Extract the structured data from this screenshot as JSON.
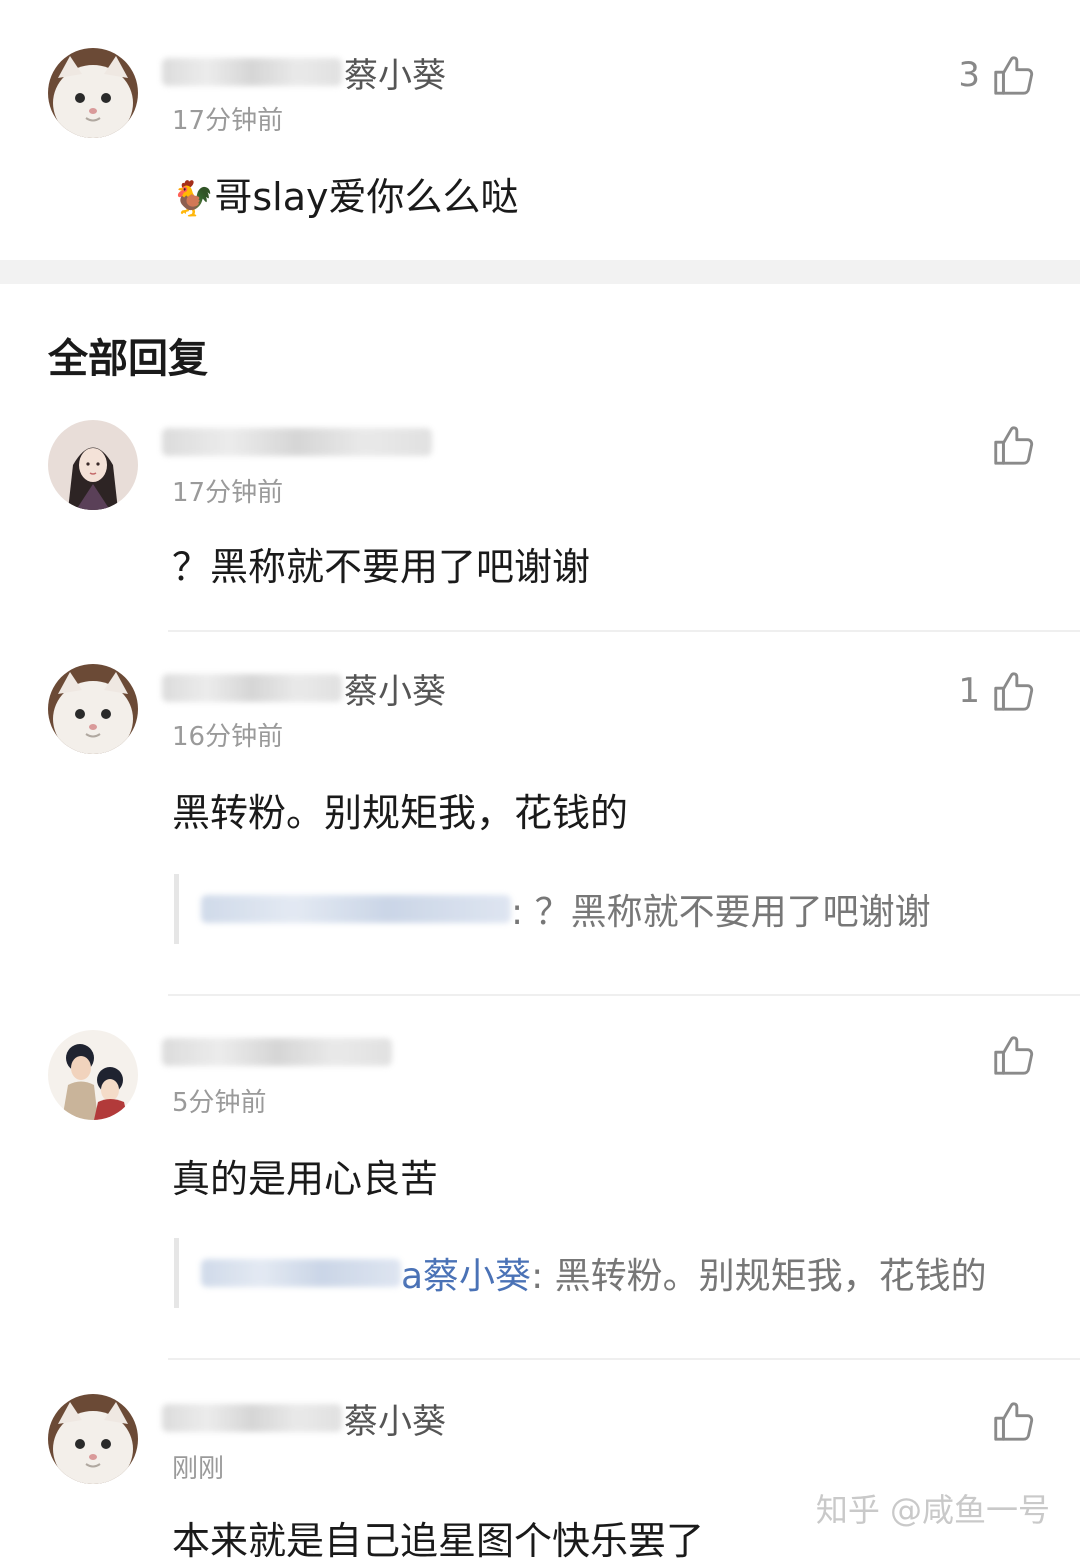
{
  "top_comment": {
    "user_suffix": "蔡小葵",
    "time": "17分钟前",
    "likes": "3",
    "emoji": "🐓",
    "text": "哥slay爱你么么哒"
  },
  "section_title": "全部回复",
  "replies": [
    {
      "user_suffix": "",
      "time": "17分钟前",
      "likes": "",
      "text": "？黑称就不要用了吧谢谢"
    },
    {
      "user_suffix": "蔡小葵",
      "time": "16分钟前",
      "likes": "1",
      "text": "黑转粉。别规矩我，花钱的",
      "quote": {
        "mention": "",
        "text": ": ？黑称就不要用了吧谢谢"
      }
    },
    {
      "user_suffix": "",
      "time": "5分钟前",
      "likes": "",
      "text": "真的是用心良苦",
      "quote": {
        "mention": "a蔡小葵",
        "text": ": 黑转粉。别规矩我，花钱的"
      }
    },
    {
      "user_suffix": "蔡小葵",
      "time": "刚刚",
      "likes": "",
      "text": "本来就是自己追星图个快乐罢了"
    }
  ],
  "watermark": "知乎 @咸鱼一号",
  "icons": {
    "like": "thumbs-up-icon",
    "avatar_cat": "white-cat-avatar",
    "avatar_girl": "illustrated-girl-avatar",
    "avatar_couple": "illustrated-couple-avatar"
  }
}
